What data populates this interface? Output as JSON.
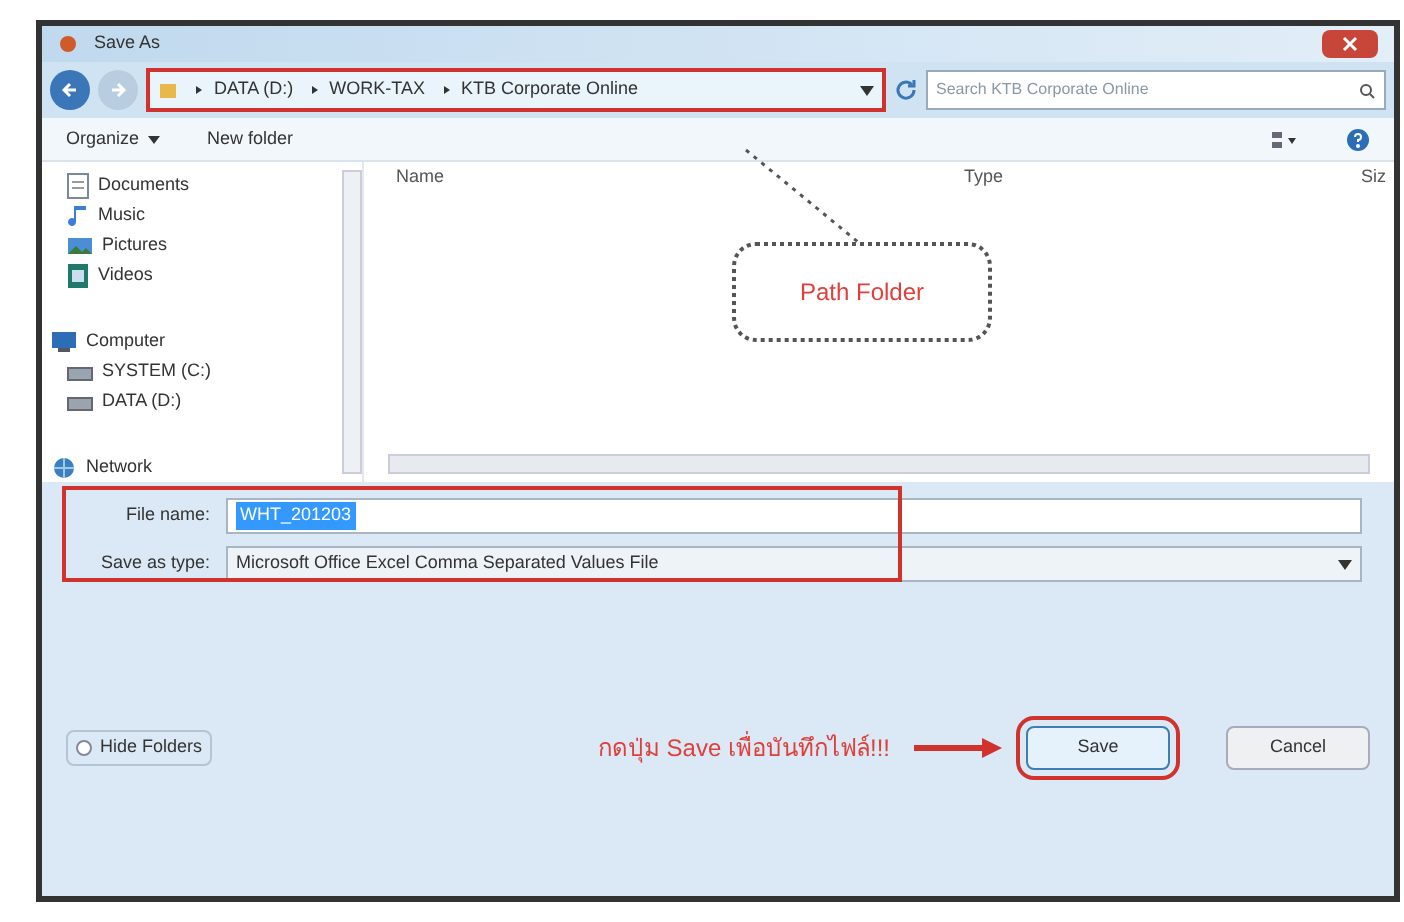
{
  "window": {
    "title": "Save As"
  },
  "address": {
    "crumbs": [
      "DATA (D:)",
      "WORK-TAX",
      "KTB Corporate Online"
    ]
  },
  "search": {
    "placeholder": "Search KTB Corporate Online"
  },
  "toolbar": {
    "organize": "Organize",
    "new_folder": "New folder"
  },
  "sidebar": {
    "items": [
      {
        "label": "Documents",
        "kind": "documents"
      },
      {
        "label": "Music",
        "kind": "music"
      },
      {
        "label": "Pictures",
        "kind": "pictures"
      },
      {
        "label": "Videos",
        "kind": "videos"
      },
      {
        "label": "Computer",
        "kind": "computer"
      },
      {
        "label": "SYSTEM (C:)",
        "kind": "drive"
      },
      {
        "label": "DATA (D:)",
        "kind": "drive"
      },
      {
        "label": "Network",
        "kind": "network"
      }
    ]
  },
  "columns": [
    "Name",
    "Type",
    "Siz"
  ],
  "callout": {
    "text": "Path Folder"
  },
  "file_name": {
    "label": "File name:",
    "value": "WHT_201203"
  },
  "save_type": {
    "label": "Save as type:",
    "value": "Microsoft Office Excel Comma Separated Values File"
  },
  "hide_folders": "Hide Folders",
  "note": "กดปุ่ม Save เพื่อบันทึกไฟล์!!!",
  "buttons": [
    {
      "label": "Save",
      "kind": "primary"
    },
    {
      "label": "Cancel",
      "kind": "normal"
    }
  ]
}
